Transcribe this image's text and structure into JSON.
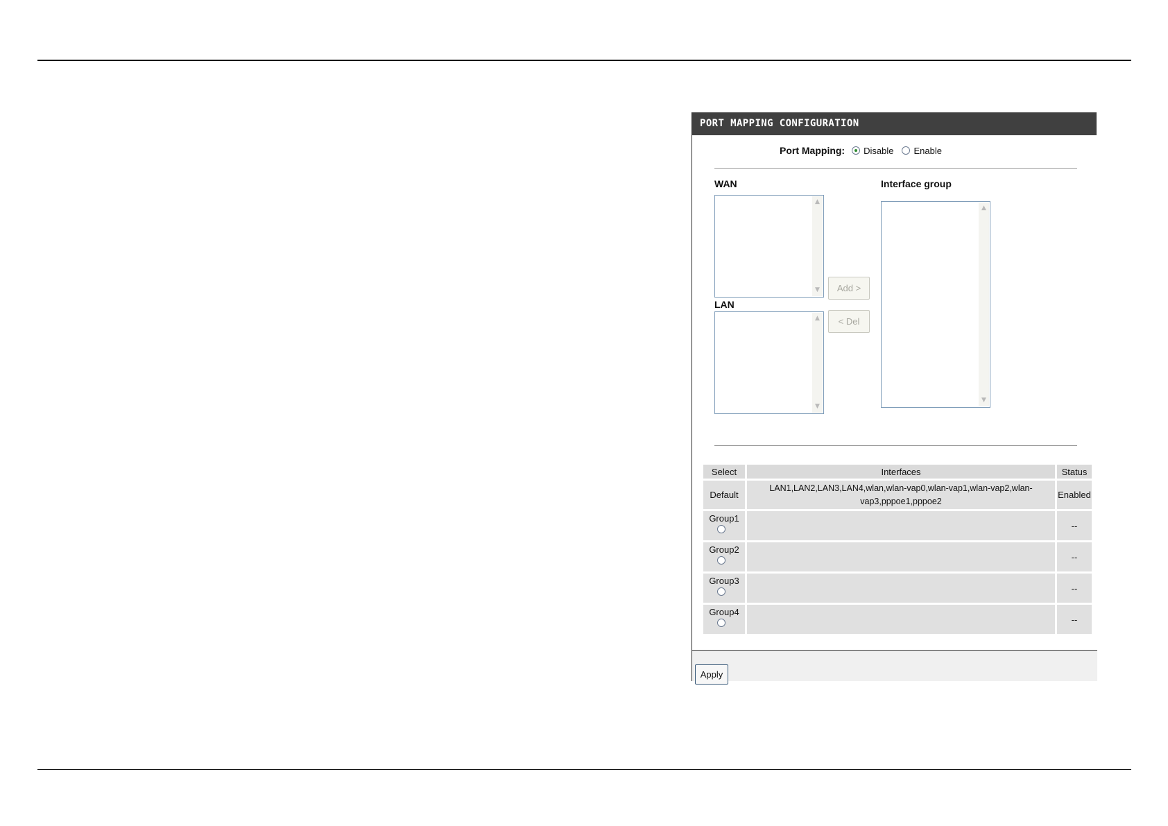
{
  "panel": {
    "title": "PORT MAPPING CONFIGURATION",
    "port_mapping": {
      "label": "Port Mapping:",
      "options": [
        "Disable",
        "Enable"
      ],
      "selected": "Disable"
    },
    "wan_label": "WAN",
    "lan_label": "LAN",
    "interface_group_label": "Interface group",
    "add_button": "Add >",
    "del_button": "< Del",
    "table": {
      "headers": [
        "Select",
        "Interfaces",
        "Status"
      ],
      "rows": [
        {
          "select": "Default",
          "interfaces": "LAN1,LAN2,LAN3,LAN4,wlan,wlan-vap0,wlan-vap1,wlan-vap2,wlan-vap3,pppoe1,pppoe2",
          "status": "Enabled"
        },
        {
          "select": "Group1",
          "interfaces": "",
          "status": "--"
        },
        {
          "select": "Group2",
          "interfaces": "",
          "status": "--"
        },
        {
          "select": "Group3",
          "interfaces": "",
          "status": "--"
        },
        {
          "select": "Group4",
          "interfaces": "",
          "status": "--"
        }
      ]
    },
    "apply_button": "Apply"
  },
  "icons": {
    "scroll_up": "chevron-up-icon",
    "scroll_down": "chevron-down-icon"
  }
}
